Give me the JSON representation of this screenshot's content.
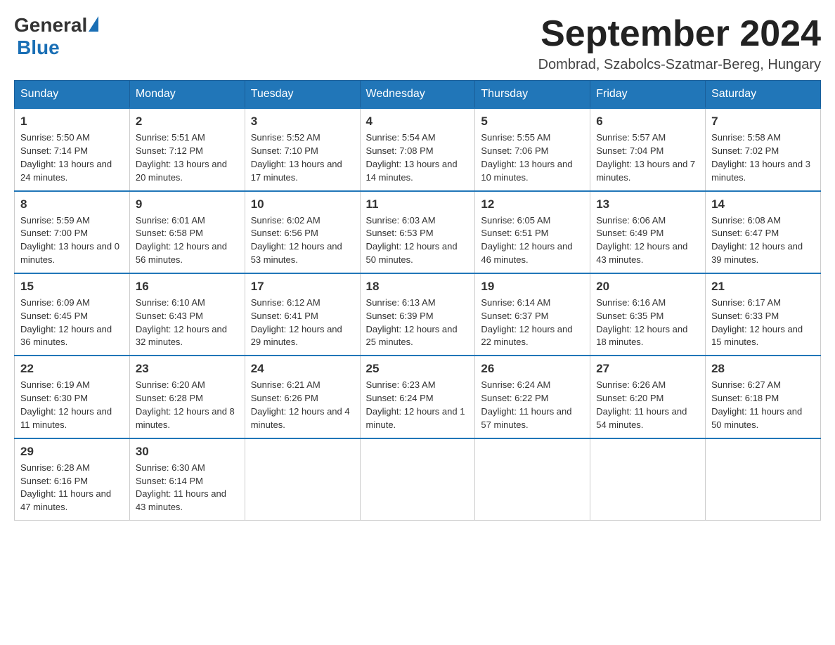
{
  "header": {
    "logo_general": "General",
    "logo_blue": "Blue",
    "month_title": "September 2024",
    "location": "Dombrad, Szabolcs-Szatmar-Bereg, Hungary"
  },
  "days_of_week": [
    "Sunday",
    "Monday",
    "Tuesday",
    "Wednesday",
    "Thursday",
    "Friday",
    "Saturday"
  ],
  "weeks": [
    [
      {
        "day": "1",
        "sunrise": "5:50 AM",
        "sunset": "7:14 PM",
        "daylight": "13 hours and 24 minutes."
      },
      {
        "day": "2",
        "sunrise": "5:51 AM",
        "sunset": "7:12 PM",
        "daylight": "13 hours and 20 minutes."
      },
      {
        "day": "3",
        "sunrise": "5:52 AM",
        "sunset": "7:10 PM",
        "daylight": "13 hours and 17 minutes."
      },
      {
        "day": "4",
        "sunrise": "5:54 AM",
        "sunset": "7:08 PM",
        "daylight": "13 hours and 14 minutes."
      },
      {
        "day": "5",
        "sunrise": "5:55 AM",
        "sunset": "7:06 PM",
        "daylight": "13 hours and 10 minutes."
      },
      {
        "day": "6",
        "sunrise": "5:57 AM",
        "sunset": "7:04 PM",
        "daylight": "13 hours and 7 minutes."
      },
      {
        "day": "7",
        "sunrise": "5:58 AM",
        "sunset": "7:02 PM",
        "daylight": "13 hours and 3 minutes."
      }
    ],
    [
      {
        "day": "8",
        "sunrise": "5:59 AM",
        "sunset": "7:00 PM",
        "daylight": "13 hours and 0 minutes."
      },
      {
        "day": "9",
        "sunrise": "6:01 AM",
        "sunset": "6:58 PM",
        "daylight": "12 hours and 56 minutes."
      },
      {
        "day": "10",
        "sunrise": "6:02 AM",
        "sunset": "6:56 PM",
        "daylight": "12 hours and 53 minutes."
      },
      {
        "day": "11",
        "sunrise": "6:03 AM",
        "sunset": "6:53 PM",
        "daylight": "12 hours and 50 minutes."
      },
      {
        "day": "12",
        "sunrise": "6:05 AM",
        "sunset": "6:51 PM",
        "daylight": "12 hours and 46 minutes."
      },
      {
        "day": "13",
        "sunrise": "6:06 AM",
        "sunset": "6:49 PM",
        "daylight": "12 hours and 43 minutes."
      },
      {
        "day": "14",
        "sunrise": "6:08 AM",
        "sunset": "6:47 PM",
        "daylight": "12 hours and 39 minutes."
      }
    ],
    [
      {
        "day": "15",
        "sunrise": "6:09 AM",
        "sunset": "6:45 PM",
        "daylight": "12 hours and 36 minutes."
      },
      {
        "day": "16",
        "sunrise": "6:10 AM",
        "sunset": "6:43 PM",
        "daylight": "12 hours and 32 minutes."
      },
      {
        "day": "17",
        "sunrise": "6:12 AM",
        "sunset": "6:41 PM",
        "daylight": "12 hours and 29 minutes."
      },
      {
        "day": "18",
        "sunrise": "6:13 AM",
        "sunset": "6:39 PM",
        "daylight": "12 hours and 25 minutes."
      },
      {
        "day": "19",
        "sunrise": "6:14 AM",
        "sunset": "6:37 PM",
        "daylight": "12 hours and 22 minutes."
      },
      {
        "day": "20",
        "sunrise": "6:16 AM",
        "sunset": "6:35 PM",
        "daylight": "12 hours and 18 minutes."
      },
      {
        "day": "21",
        "sunrise": "6:17 AM",
        "sunset": "6:33 PM",
        "daylight": "12 hours and 15 minutes."
      }
    ],
    [
      {
        "day": "22",
        "sunrise": "6:19 AM",
        "sunset": "6:30 PM",
        "daylight": "12 hours and 11 minutes."
      },
      {
        "day": "23",
        "sunrise": "6:20 AM",
        "sunset": "6:28 PM",
        "daylight": "12 hours and 8 minutes."
      },
      {
        "day": "24",
        "sunrise": "6:21 AM",
        "sunset": "6:26 PM",
        "daylight": "12 hours and 4 minutes."
      },
      {
        "day": "25",
        "sunrise": "6:23 AM",
        "sunset": "6:24 PM",
        "daylight": "12 hours and 1 minute."
      },
      {
        "day": "26",
        "sunrise": "6:24 AM",
        "sunset": "6:22 PM",
        "daylight": "11 hours and 57 minutes."
      },
      {
        "day": "27",
        "sunrise": "6:26 AM",
        "sunset": "6:20 PM",
        "daylight": "11 hours and 54 minutes."
      },
      {
        "day": "28",
        "sunrise": "6:27 AM",
        "sunset": "6:18 PM",
        "daylight": "11 hours and 50 minutes."
      }
    ],
    [
      {
        "day": "29",
        "sunrise": "6:28 AM",
        "sunset": "6:16 PM",
        "daylight": "11 hours and 47 minutes."
      },
      {
        "day": "30",
        "sunrise": "6:30 AM",
        "sunset": "6:14 PM",
        "daylight": "11 hours and 43 minutes."
      },
      null,
      null,
      null,
      null,
      null
    ]
  ]
}
